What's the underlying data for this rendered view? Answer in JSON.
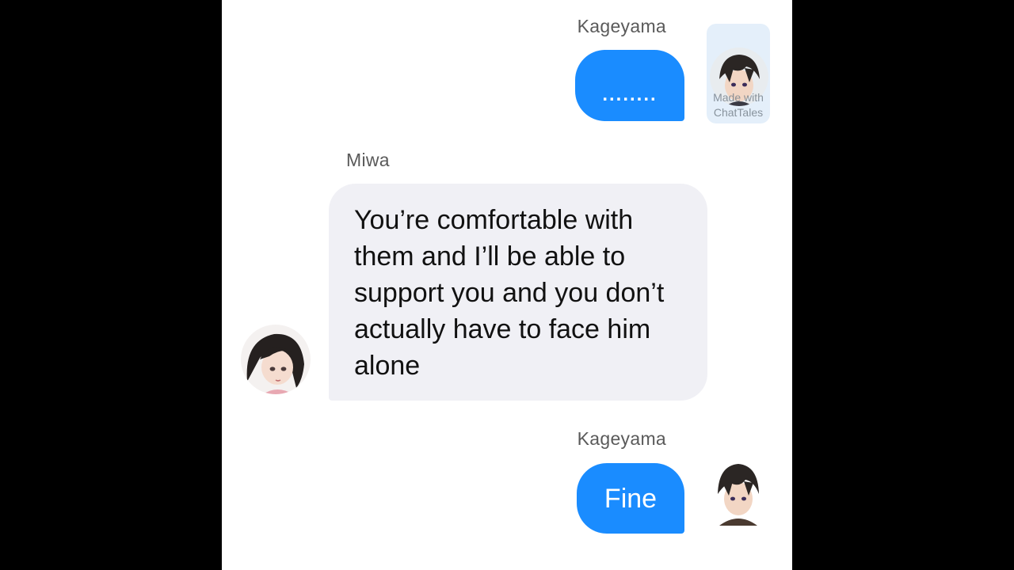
{
  "conversation": {
    "messages": [
      {
        "sender": "Kageyama",
        "direction": "outgoing",
        "text": "........",
        "avatar_icon": "kageyama-avatar-icon"
      },
      {
        "sender": "Miwa",
        "direction": "incoming",
        "text": "You’re comfortable with them and I’ll be able to support you and you don’t actually have to face him alone",
        "avatar_icon": "miwa-avatar-icon"
      },
      {
        "sender": "Kageyama",
        "direction": "outgoing",
        "text": "Fine",
        "avatar_icon": "kageyama-avatar-icon"
      }
    ]
  },
  "watermark": {
    "text": "Made with\nChatTales"
  },
  "colors": {
    "outgoing_bubble": "#1a8cff",
    "incoming_bubble": "#f0f0f5",
    "background_panel": "#ffffff",
    "letterbox": "#000000"
  }
}
